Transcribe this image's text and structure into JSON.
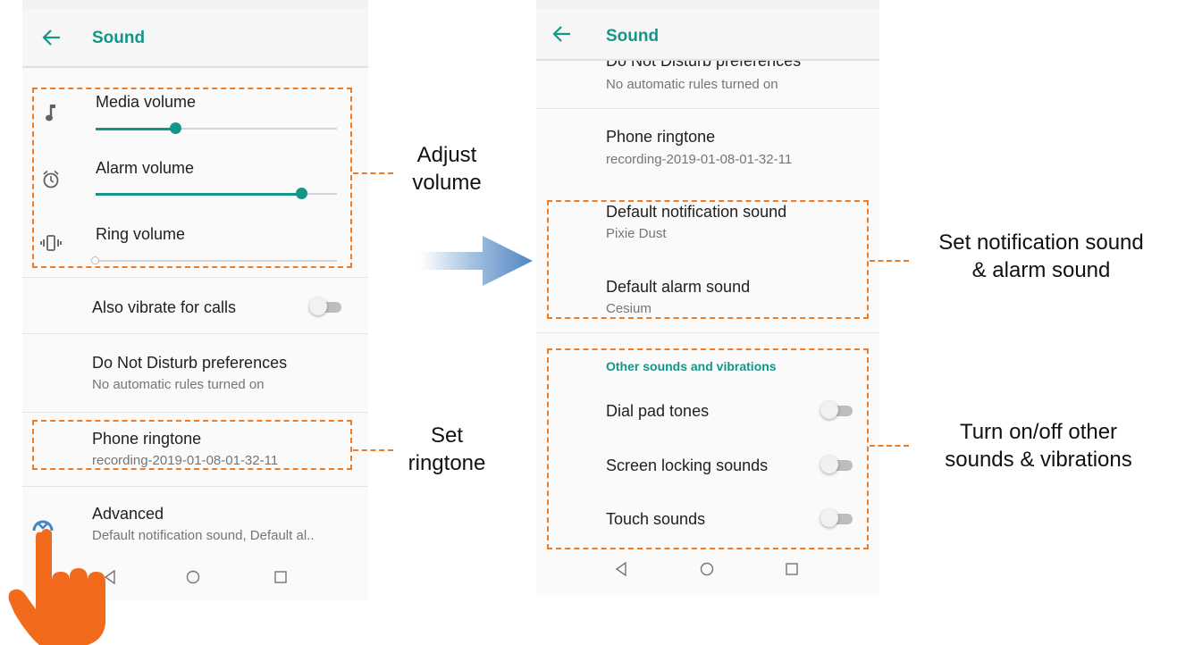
{
  "left": {
    "title": "Sound",
    "media_volume": {
      "label": "Media volume",
      "level": 0.33
    },
    "alarm_volume": {
      "label": "Alarm volume",
      "level": 0.86
    },
    "ring_volume": {
      "label": "Ring volume",
      "level": 0.0
    },
    "vibrate_calls": {
      "label": "Also vibrate for calls",
      "on": false
    },
    "dnd": {
      "title": "Do Not Disturb preferences",
      "subtitle": "No automatic rules turned on"
    },
    "ringtone": {
      "title": "Phone ringtone",
      "subtitle": "recording-2019-01-08-01-32-11"
    },
    "advanced": {
      "title": "Advanced",
      "subtitle": "Default notification sound, Default al.."
    }
  },
  "right": {
    "title": "Sound",
    "dnd": {
      "title": "Do Not Disturb preferences",
      "subtitle": "No automatic rules turned on"
    },
    "ringtone": {
      "title": "Phone ringtone",
      "subtitle": "recording-2019-01-08-01-32-11"
    },
    "notification_sound": {
      "title": "Default notification sound",
      "subtitle": "Pixie Dust"
    },
    "alarm_sound": {
      "title": "Default alarm sound",
      "subtitle": "Cesium"
    },
    "other_header": "Other sounds and vibrations",
    "toggles": [
      {
        "label": "Dial pad tones",
        "on": false
      },
      {
        "label": "Screen locking sounds",
        "on": false
      },
      {
        "label": "Touch sounds",
        "on": false
      }
    ]
  },
  "annotations": {
    "adjust_volume": [
      "Adjust",
      "volume"
    ],
    "set_ringtone": [
      "Set",
      "ringtone"
    ],
    "set_notification": [
      "Set notification sound",
      "& alarm sound"
    ],
    "other_sounds": [
      "Turn on/off other",
      "sounds & vibrations"
    ]
  },
  "colors": {
    "accent": "#159588",
    "annotation": "#f07b22",
    "hand": "#f26a1b",
    "arrow": "#5b8fc4"
  },
  "icons": [
    "back-arrow-icon",
    "music-note-icon",
    "alarm-clock-icon",
    "vibrate-icon",
    "advanced-expand-icon",
    "nav-back-icon",
    "nav-home-icon",
    "nav-recents-icon",
    "pointing-hand-icon",
    "flow-arrow-icon"
  ]
}
